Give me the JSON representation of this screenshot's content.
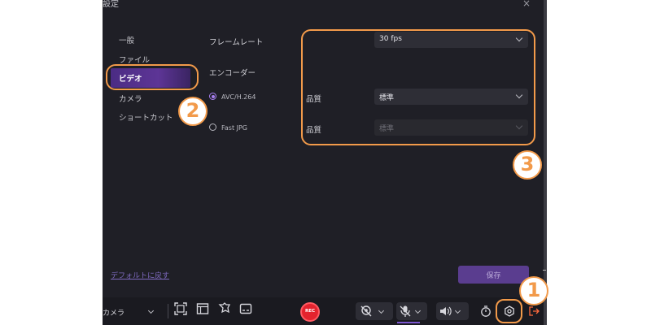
{
  "dialog": {
    "title": "設定",
    "close_glyph": "×"
  },
  "sidebar": {
    "items": [
      {
        "label": "一般"
      },
      {
        "label": "ファイル"
      },
      {
        "label": "ビデオ",
        "active": true
      },
      {
        "label": "カメラ"
      },
      {
        "label": "ショートカット"
      }
    ]
  },
  "video": {
    "framerate_label": "フレームレート",
    "framerate_value": "30 fps",
    "encoder_label": "エンコーダー",
    "encoders": [
      {
        "label": "AVC/H.264",
        "selected": true
      },
      {
        "label": "Fast JPG",
        "selected": false
      }
    ],
    "quality_label_1": "品質",
    "quality_value_1": "標準",
    "quality_label_2": "品質",
    "quality_value_2": "標準"
  },
  "footer": {
    "reset_label": "デフォルトに戻す",
    "save_label": "保存"
  },
  "toolbar": {
    "camera_label": "カメラ",
    "rec_label": "REC"
  },
  "callouts": {
    "one": "1",
    "two": "2",
    "three": "3"
  },
  "colors": {
    "accent": "#5a3d8f",
    "callout": "#f29a4a",
    "rec": "#e3232e"
  }
}
